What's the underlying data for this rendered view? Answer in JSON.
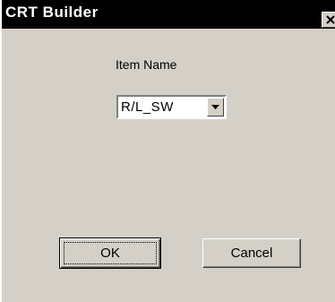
{
  "window": {
    "title": "CRT Builder"
  },
  "form": {
    "item_name_label": "Item Name",
    "item_name_value": "R/L_SW"
  },
  "buttons": {
    "ok_label": "OK",
    "cancel_label": "Cancel"
  },
  "icons": {
    "close": "close-icon",
    "dropdown": "chevron-down-icon"
  },
  "colors": {
    "titlebar": "#000000",
    "dialog_face": "#d4d0c8",
    "field_background": "#ffffff"
  }
}
